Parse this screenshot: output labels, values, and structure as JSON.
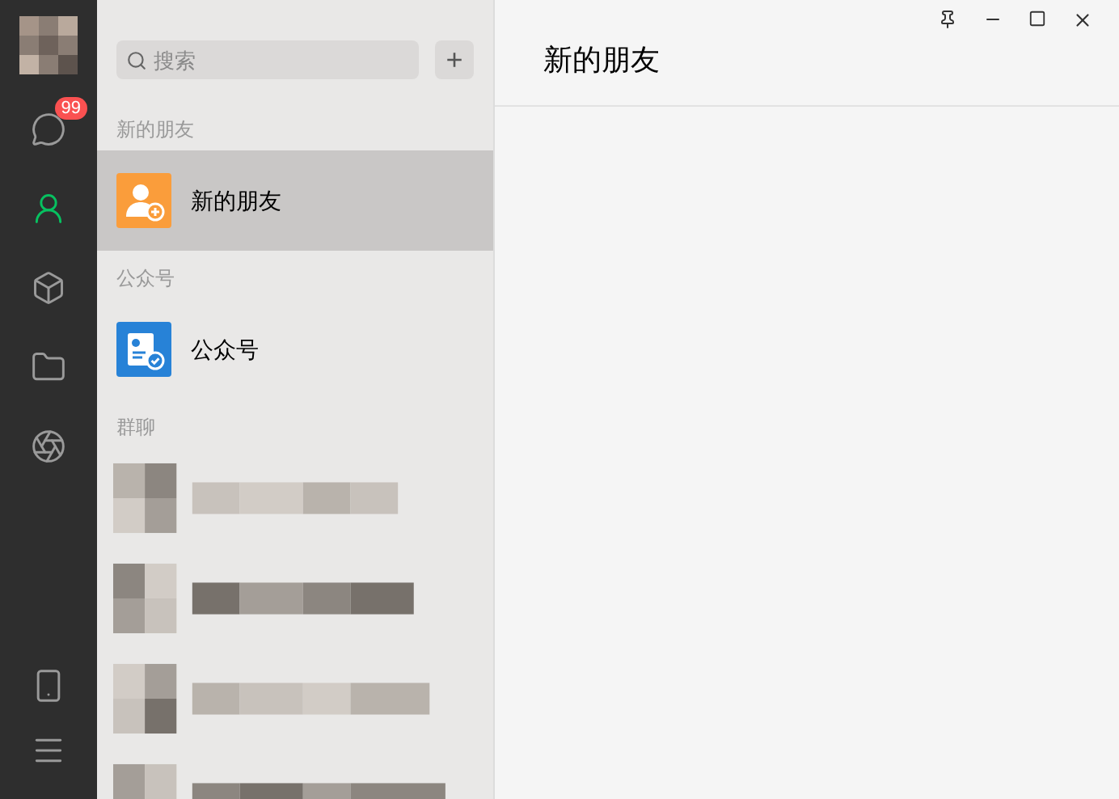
{
  "sidebar": {
    "items": [
      {
        "kind": "chat",
        "selected": false,
        "badge": "99"
      },
      {
        "kind": "contacts",
        "selected": true
      },
      {
        "kind": "box",
        "selected": false
      },
      {
        "kind": "folder",
        "selected": false
      },
      {
        "kind": "moments",
        "selected": false
      }
    ],
    "bottom": [
      {
        "kind": "phone"
      },
      {
        "kind": "menu"
      }
    ]
  },
  "search": {
    "placeholder": "搜索",
    "add": "+"
  },
  "sections": [
    {
      "title": "新的朋友",
      "items": [
        {
          "kind": "new-friend",
          "label": "新的朋友",
          "selected": true
        }
      ]
    },
    {
      "title": "公众号",
      "items": [
        {
          "kind": "official",
          "label": "公众号",
          "selected": false
        }
      ]
    },
    {
      "title": "群聊"
    }
  ],
  "main": {
    "title": "新的朋友"
  }
}
